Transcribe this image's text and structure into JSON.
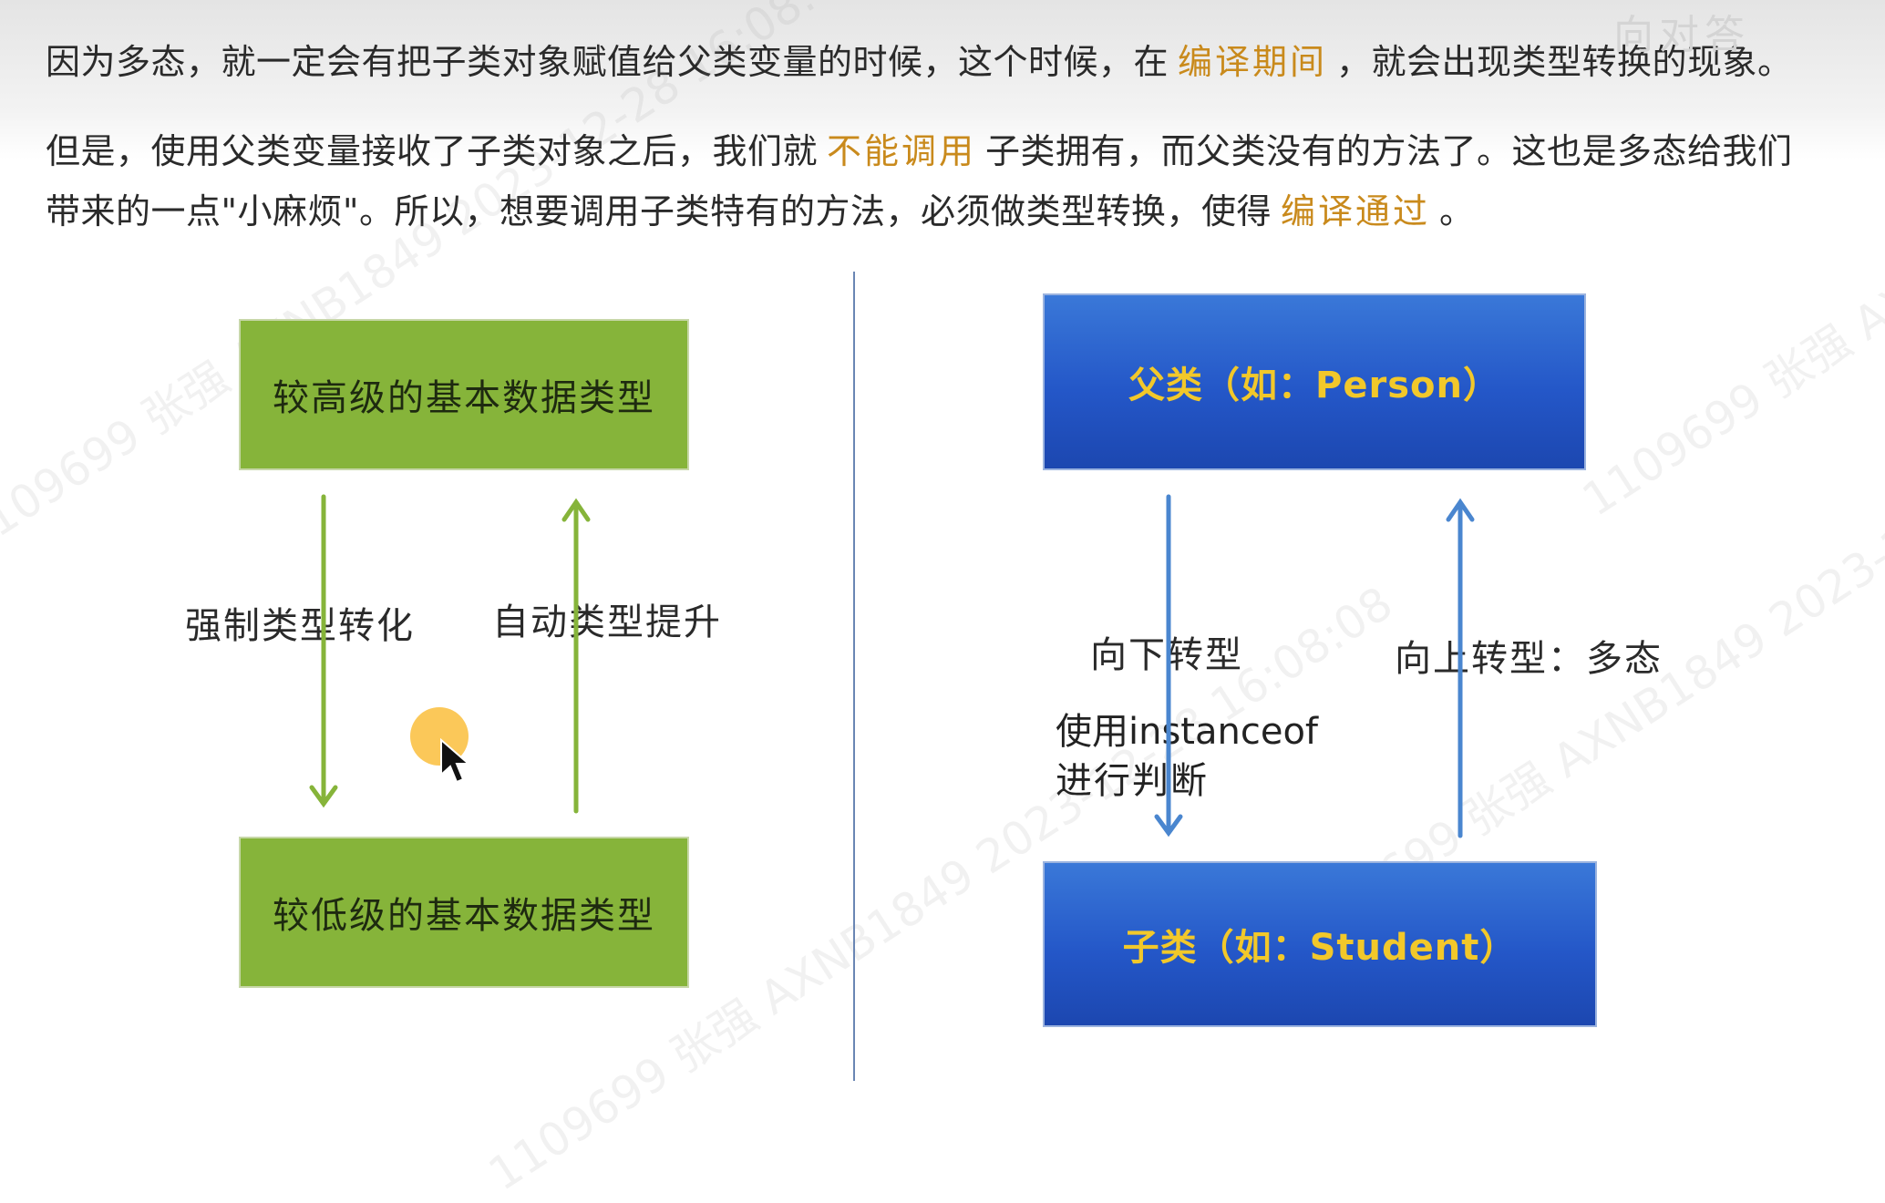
{
  "paragraphs": {
    "p1": {
      "a": "因为多态，就一定会有把子类对象赋值给父类变量的时候，这个时候，在",
      "hl": "编译期间",
      "b": "，就会出现类型转换的现象。"
    },
    "p2": {
      "a": "但是，使用父类变量接收了子类对象之后，我们就",
      "hl": "不能调用",
      "b": "子类拥有，而父类没有的方法了。这也是多态给我们"
    },
    "p3": {
      "a": "带来的一点\"小麻烦\"。所以，想要调用子类特有的方法，必须做类型转换，使得",
      "hl": "编译通过",
      "b": "。"
    }
  },
  "top_right_faint": "向对答",
  "left_diagram": {
    "high_box": "较高级的基本数据类型",
    "low_box": "较低级的基本数据类型",
    "down_label": "强制类型转化",
    "up_label": "自动类型提升"
  },
  "right_diagram": {
    "parent_box": "父类（如：Person）",
    "child_box": "子类（如：Student）",
    "down_label": "向下转型",
    "instanceof_line1": "使用instanceof",
    "instanceof_line2": "进行判断",
    "up_label": "向上转型：多态"
  },
  "watermarks": [
    "1109699 张强 AXNB1849 2023-12-28 16:08:08"
  ],
  "colors": {
    "highlight": "#c98a1c",
    "green_box": "#86b43a",
    "blue_box": "#2457c8",
    "blue_text": "#f2c82a",
    "green_arrow": "#86b43a",
    "blue_arrow": "#4a86cf"
  }
}
